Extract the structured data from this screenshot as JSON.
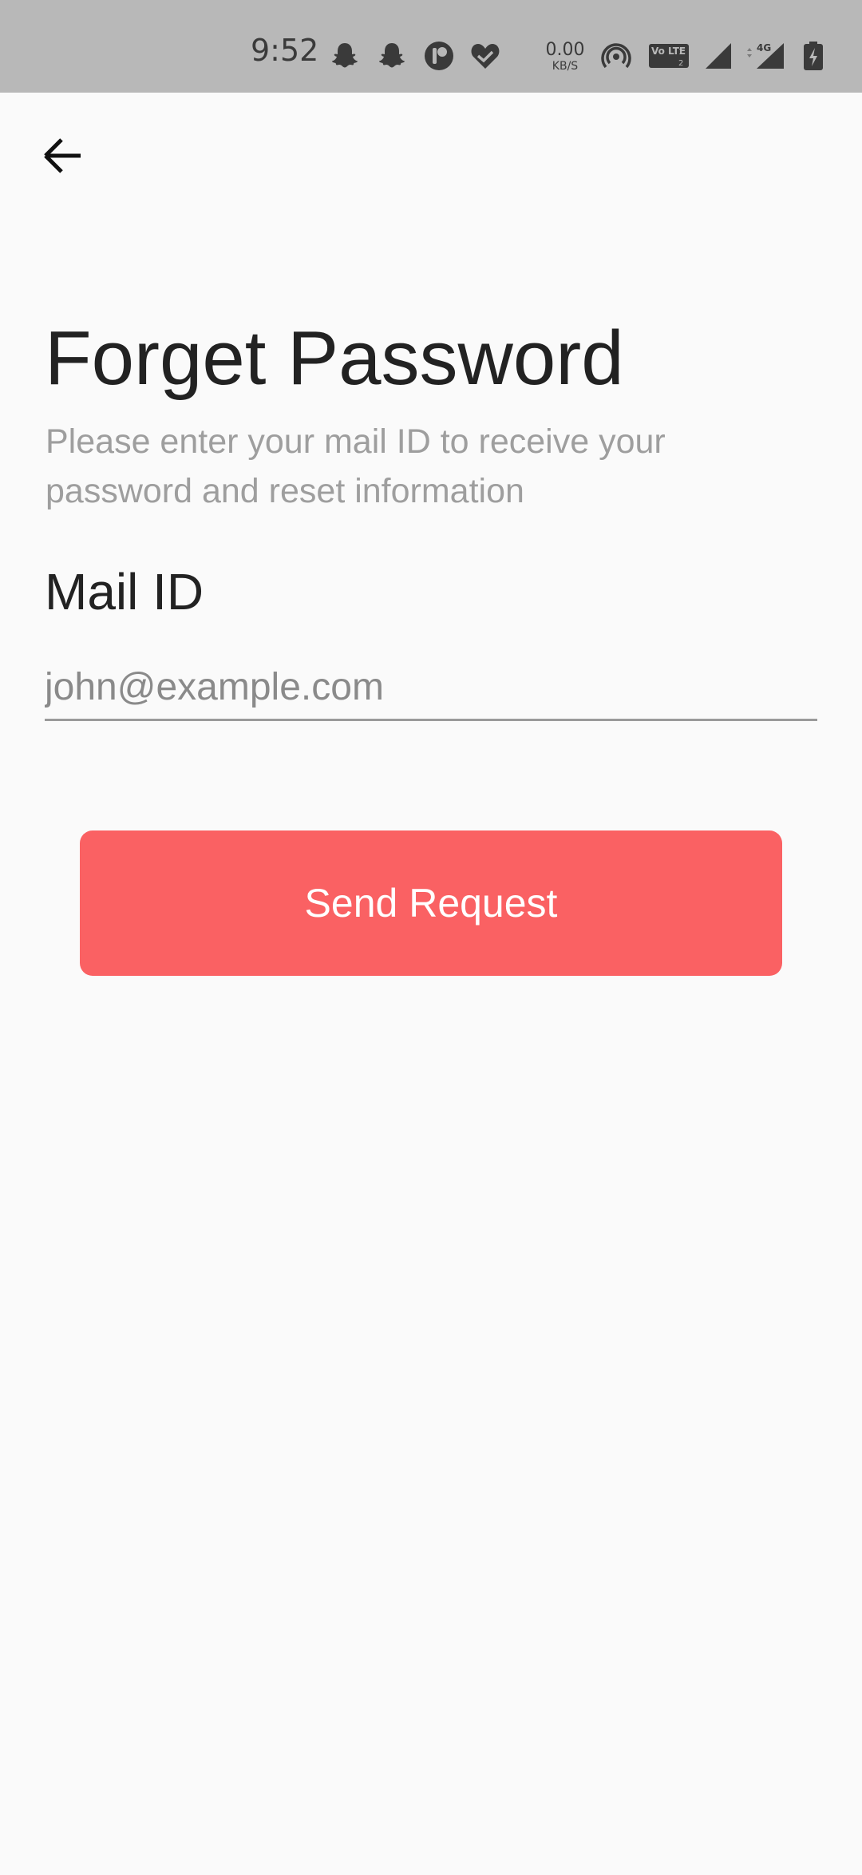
{
  "status_bar": {
    "time": "9:52",
    "net_speed_value": "0.00",
    "net_speed_unit": "KB/S",
    "icons": [
      "snapchat-icon",
      "snapchat-icon",
      "app-icon",
      "heart-check-icon",
      "hotspot-icon",
      "volte-icon",
      "signal-icon",
      "signal-4g-icon",
      "battery-charging-icon"
    ],
    "volte_text": "Vo LTE",
    "network_type": "4G",
    "background_color": "#b8b8b8"
  },
  "header": {
    "back_icon": "arrow-left-icon"
  },
  "main": {
    "title": "Forget Password",
    "subtitle": "Please enter your mail ID to receive your password and reset information",
    "mail_label": "Mail ID",
    "mail_placeholder": "john@example.com",
    "mail_value": "",
    "send_button_label": "Send Request"
  },
  "colors": {
    "accent": "#fa6163",
    "title_text": "#222222",
    "subtitle_text": "#9e9e9e",
    "background": "#fafafa"
  }
}
